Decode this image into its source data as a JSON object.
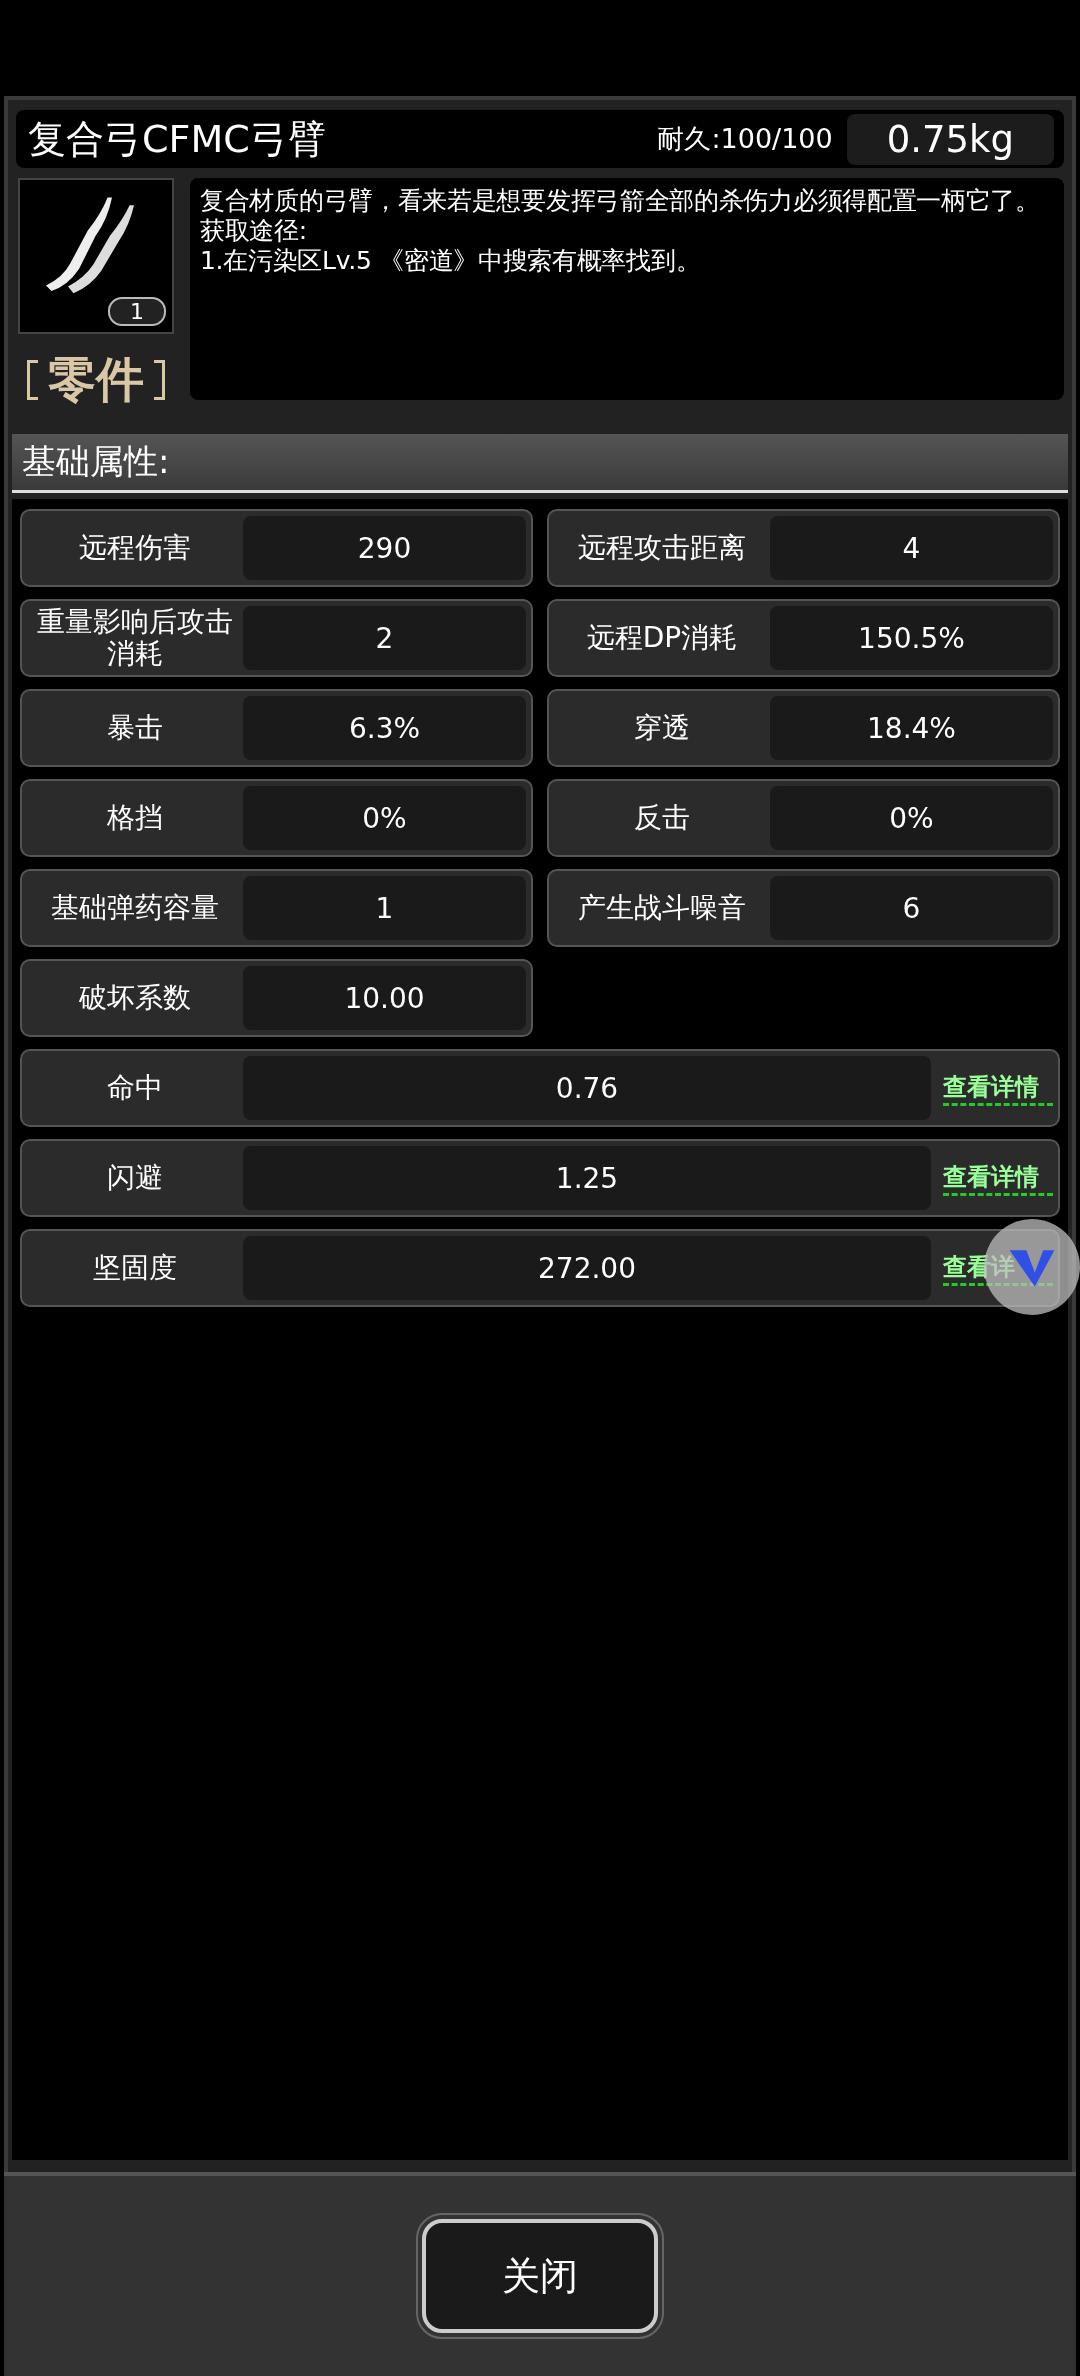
{
  "item": {
    "name": "复合弓CFMC弓臂",
    "durability": "耐久:100/100",
    "weight": "0.75kg",
    "count": "1",
    "category": "零件",
    "description": [
      "复合材质的弓臂，看来若是想要发挥弓箭全部的杀伤力必须得配置一柄它了。",
      "获取途径:",
      "1.在污染区Lv.5 《密道》中搜索有概率找到。"
    ]
  },
  "section": {
    "title": "基础属性:"
  },
  "stats": [
    {
      "label": "远程伤害",
      "value": "290"
    },
    {
      "label": "远程攻击距离",
      "value": "4"
    },
    {
      "label": "重量影响后攻击消耗",
      "value": "2"
    },
    {
      "label": "远程DP消耗",
      "value": "150.5%"
    },
    {
      "label": "暴击",
      "value": "6.3%"
    },
    {
      "label": "穿透",
      "value": "18.4%"
    },
    {
      "label": "格挡",
      "value": "0%"
    },
    {
      "label": "反击",
      "value": "0%"
    },
    {
      "label": "基础弹药容量",
      "value": "1"
    },
    {
      "label": "产生战斗噪音",
      "value": "6"
    },
    {
      "label": "破坏系数",
      "value": "10.00"
    }
  ],
  "detail_stats": [
    {
      "label": "命中",
      "value": "0.76",
      "link": "查看详情"
    },
    {
      "label": "闪避",
      "value": "1.25",
      "link": "查看详情"
    },
    {
      "label": "坚固度",
      "value": "272.00",
      "link": "查看详"
    }
  ],
  "footer": {
    "close_button": "关闭"
  }
}
